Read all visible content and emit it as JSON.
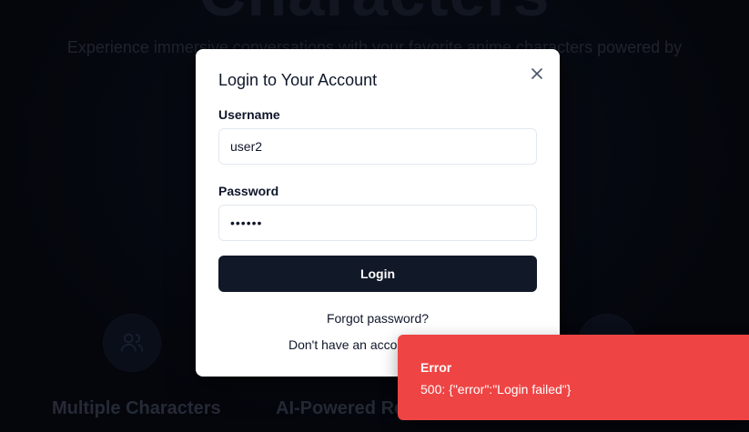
{
  "background": {
    "hero_title": "Characters",
    "hero_subtitle": "Experience immersive conversations with your favorite anime characters powered by",
    "features": [
      {
        "title": "Multiple Characters",
        "icon": "users-icon"
      },
      {
        "title": "AI-Powered Re",
        "icon": "sparkle-icon"
      }
    ]
  },
  "login_modal": {
    "title": "Login to Your Account",
    "close_icon": "close-icon",
    "username_label": "Username",
    "username_value": "user2",
    "password_label": "Password",
    "password_value": "••••••",
    "login_button": "Login",
    "forgot_password": "Forgot password?",
    "no_account_text": "Don't have an accou"
  },
  "toast": {
    "title": "Error",
    "message": "500: {\"error\":\"Login failed\"}",
    "color": "#ef4444"
  },
  "colors": {
    "primary_button": "#111827",
    "background": "#070a13"
  }
}
